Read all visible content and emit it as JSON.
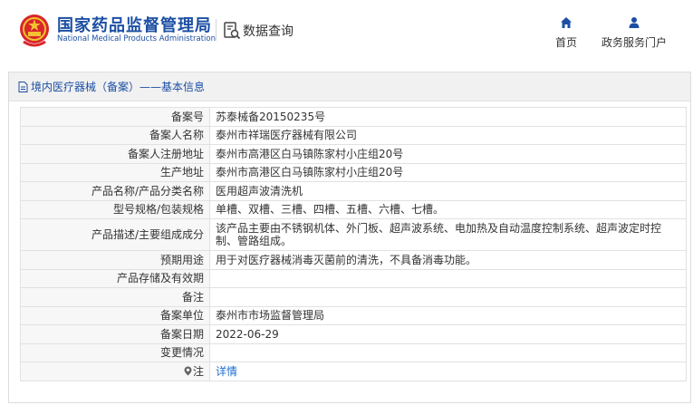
{
  "header": {
    "title_cn": "国家药品监督管理局",
    "title_en": "National Medical Products Administration",
    "db_query": "数据查询",
    "nav": [
      {
        "label": "首页",
        "icon": "home-icon"
      },
      {
        "label": "政务服务门户",
        "icon": "user-icon"
      }
    ]
  },
  "panel": {
    "title": "境内医疗器械（备案）——基本信息"
  },
  "record": {
    "rows": [
      {
        "label": "备案号",
        "value": "苏泰械备20150235号"
      },
      {
        "label": "备案人名称",
        "value": "泰州市祥瑞医疗器械有限公司"
      },
      {
        "label": "备案人注册地址",
        "value": "泰州市高港区白马镇陈家村小庄组20号"
      },
      {
        "label": "生产地址",
        "value": "泰州市高港区白马镇陈家村小庄组20号"
      },
      {
        "label": "产品名称/产品分类名称",
        "value": "医用超声波清洗机"
      },
      {
        "label": "型号规格/包装规格",
        "value": "单槽、双槽、三槽、四槽、五槽、六槽、七槽。"
      },
      {
        "label": "产品描述/主要组成成分",
        "value": "该产品主要由不锈钢机体、外门板、超声波系统、电加热及自动温度控制系统、超声波定时控制、管路组成。"
      },
      {
        "label": "预期用途",
        "value": "用于对医疗器械消毒灭菌前的清洗，不具备消毒功能。"
      },
      {
        "label": "产品存储及有效期",
        "value": ""
      },
      {
        "label": "备注",
        "value": ""
      },
      {
        "label": "备案单位",
        "value": "泰州市市场监督管理局"
      },
      {
        "label": "备案日期",
        "value": "2022-06-29"
      },
      {
        "label": "变更情况",
        "value": ""
      },
      {
        "label": "注",
        "value": "详情"
      }
    ]
  },
  "colors": {
    "brand_blue": "#1c4fa3",
    "link_blue": "#1c6fd1",
    "label_bg": "#f7f7f7",
    "panel_head_bg": "#f1f1f1"
  }
}
